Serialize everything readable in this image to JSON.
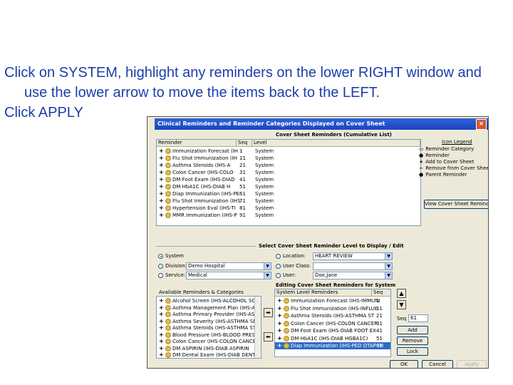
{
  "slide": {
    "instruction1": "Click on SYSTEM, highlight any reminders on the lower RIGHT window and use the lower arrow to move the items back to the LEFT.",
    "instruction2": "Click APPLY"
  },
  "window": {
    "title": "Clinical Reminders and Reminder Categories Displayed on Cover Sheet",
    "close_glyph": "×",
    "top_list_title": "Cover Sheet Reminders (Cumulative List)",
    "columns": {
      "reminder": "Reminder",
      "seq": "Seq",
      "level": "Level"
    },
    "top_rows": [
      {
        "name": "Immunization Forecast (IH",
        "seq": "1",
        "level": "System"
      },
      {
        "name": "Flu Shot Immunization (IH",
        "seq": "11",
        "level": "System"
      },
      {
        "name": "Asthma Steroids (IHS-A",
        "seq": "21",
        "level": "System"
      },
      {
        "name": "Colon Cancer (IHS-COLO",
        "seq": "31",
        "level": "System"
      },
      {
        "name": "DM Foot Exam (IHS-DIAD",
        "seq": "41",
        "level": "System"
      },
      {
        "name": "DM HbA1C (IHS-DIAB H",
        "seq": "51",
        "level": "System"
      },
      {
        "name": "Diap Immunization (IHS-PE",
        "seq": "61",
        "level": "System"
      },
      {
        "name": "Flu Shot Immunization (IHS",
        "seq": "71",
        "level": "System"
      },
      {
        "name": "Hypertension Eval (IHS-TI",
        "seq": "81",
        "level": "System"
      },
      {
        "name": "MMR Immunization (IHS-P",
        "seq": "91",
        "level": "System"
      }
    ],
    "icon_legend": {
      "title": "Icon Legend",
      "items": [
        {
          "glyph": "▭",
          "label": "Reminder Category"
        },
        {
          "glyph": "●",
          "label": "Reminder"
        },
        {
          "glyph": "+",
          "label": "Add to Cover Sheet"
        },
        {
          "glyph": "−",
          "label": "Remove from Cover Sheet"
        },
        {
          "glyph": "●",
          "label": "Parent Reminder"
        }
      ]
    },
    "view_button": "View Cover Sheet Reminders",
    "level_section_title": "Select Cover Sheet Reminder Level to Display / Edit",
    "levels": {
      "system": "System",
      "division": "Division:",
      "division_value": "Demo Hospital",
      "service": "Service:",
      "service_value": "Medical",
      "location": "Location:",
      "location_value": "HEART REVIEW",
      "user_class": "User Class:",
      "user": "User:",
      "user_value": "Doe,Jane"
    },
    "available_title": "Available Reminders & Categories",
    "available_rows": [
      "Alcohol Screen (IHS-ALCOHOL SCRE",
      "Asthma Management Plan (IHS-ASTHMA",
      "Asthma Primary Provider (IHS-ASTHMA",
      "Asthma Severity (IHS-ASTHMA SEVERI",
      "Asthma Steroids (IHS-ASTHMA STE",
      "Blood Pressure (IHS-BLOOD PRESSU",
      "Colon Cancer (IHS-COLON CANCER",
      "DM ASPIRIN (IHS-DIAB ASPIRIN",
      "DM Dental Exam (IHS-DIAB DENT"
    ],
    "editing_title": "Editing Cover Sheet Reminders for System",
    "editing_columns": {
      "reminder": "System Level Reminders",
      "seq": "Seq"
    },
    "editing_rows": [
      {
        "name": "Immunization Forecast (IHS-IMMUNI",
        "seq": "1"
      },
      {
        "name": "Flu Shot Immunization (IHS-INFLUE",
        "seq": "11"
      },
      {
        "name": "Asthma Steroids (IHS-ASTHMA ST",
        "seq": "21"
      },
      {
        "name": "Colon Cancer (IHS-COLON CANCER",
        "seq": "31"
      },
      {
        "name": "DM Foot Exam (IHS-DIAB FOOT EX",
        "seq": "41"
      },
      {
        "name": "DM HbA1C (IHS-DIAB HGBA1C)",
        "seq": "51"
      },
      {
        "name": "Diap Immunization (IHS-PED DTAP IM",
        "seq": "61"
      }
    ],
    "seq_label": "Seq",
    "seq_value": "61",
    "add_button": "Add",
    "remove_button": "Remove",
    "lock_button": "Lock",
    "ok_button": "OK",
    "cancel_button": "Cancel",
    "apply_button": "Apply",
    "up_glyph": "▲",
    "down_glyph": "▼",
    "right_glyph": "➡",
    "left_glyph": "⬅"
  }
}
